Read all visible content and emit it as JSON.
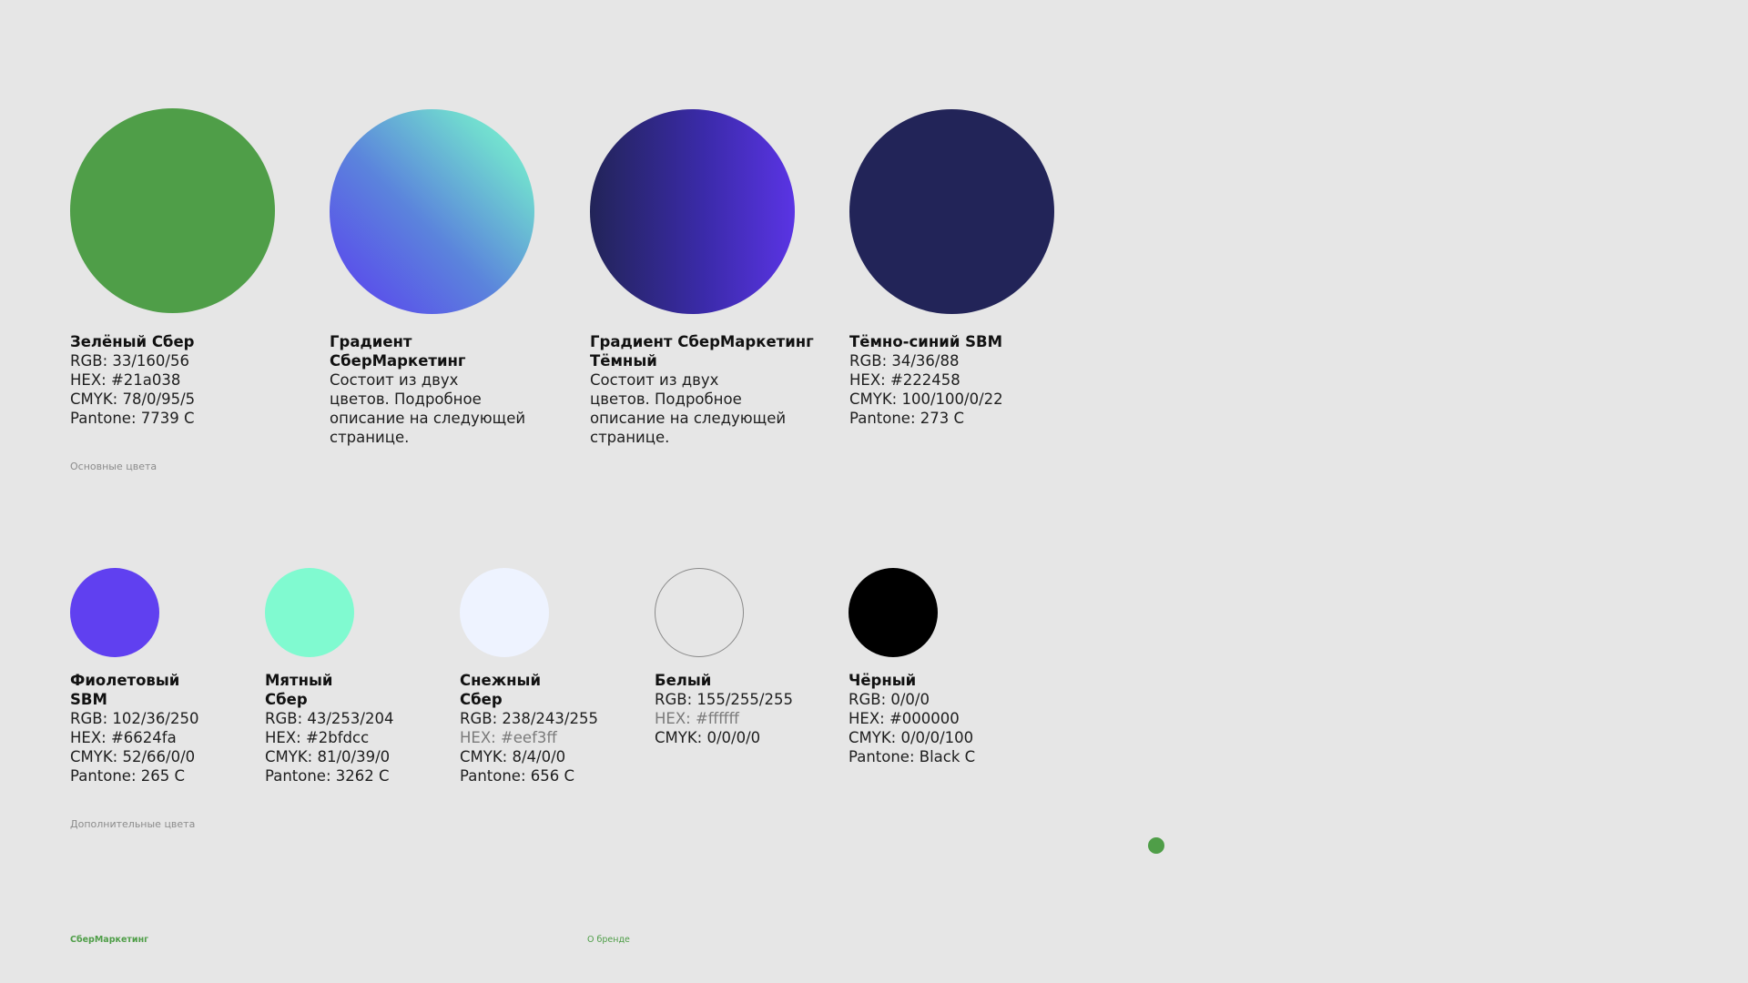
{
  "main_colors": {
    "caption": "Основные цвета",
    "items": [
      {
        "title": "Зелёный Сбер",
        "lines": [
          "RGB: 33/160/56",
          "HEX: #21a038",
          "CMYK: 78/0/95/5",
          "Pantone: 7739 C"
        ]
      },
      {
        "title_1": "Градиент",
        "title_2": "СберМаркетинг",
        "description": [
          "Состоит из двух",
          "цветов. Подробное",
          "описание на следующей",
          "странице."
        ]
      },
      {
        "title_1": "Градиент СберМаркетинг",
        "title_2": "Тёмный",
        "description": [
          "Состоит из двух",
          "цветов. Подробное",
          "описание на следующей",
          "странице."
        ]
      },
      {
        "title": "Тёмно-синий SBM",
        "lines": [
          "RGB: 34/36/88",
          "HEX: #222458",
          "CMYK: 100/100/0/22",
          "Pantone: 273 C"
        ]
      }
    ]
  },
  "additional_colors": {
    "caption": "Дополнительные цвета",
    "items": [
      {
        "title_1": "Фиолетовый",
        "title_2": "SBM",
        "lines": [
          "RGB: 102/36/250",
          "HEX: #6624fa",
          "CMYK: 52/66/0/0",
          "Pantone: 265 C"
        ]
      },
      {
        "title_1": "Мятный",
        "title_2": "Сбер",
        "lines": [
          "RGB: 43/253/204",
          "HEX: #2bfdcc",
          "CMYK: 81/0/39/0",
          "Pantone: 3262 C"
        ]
      },
      {
        "title_1": "Снежный",
        "title_2": "Сбер",
        "lines": [
          "RGB: 238/243/255",
          "HEX: #eef3ff",
          "CMYK: 8/4/0/0",
          "Pantone: 656 C"
        ]
      },
      {
        "title": "Белый",
        "lines": [
          "RGB: 155/255/255",
          "HEX: #ffffff",
          "CMYK: 0/0/0/0"
        ]
      },
      {
        "title": "Чёрный",
        "lines": [
          "RGB: 0/0/0",
          "HEX: #000000",
          "CMYK: 0/0/0/100",
          "Pantone: Black C"
        ]
      }
    ]
  },
  "footer": {
    "logo": "СберМаркетинг",
    "section": "О бренде"
  },
  "colors": {
    "background": "#e6e6e6",
    "green": "#4f9e48",
    "navy": "#222458",
    "violet": "#6040f0",
    "mint": "#80fad0",
    "snow": "#eef3ff",
    "black": "#000000"
  }
}
